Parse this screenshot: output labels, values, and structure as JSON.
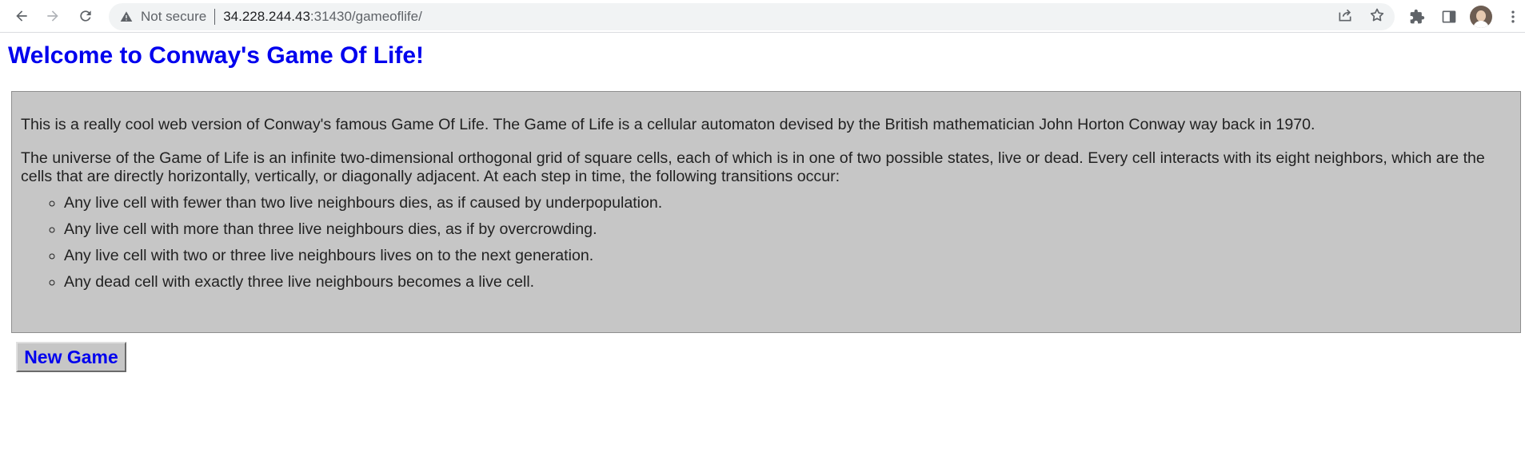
{
  "browser": {
    "security_label": "Not secure",
    "url_host": "34.228.244.43",
    "url_rest": ":31430/gameoflife/",
    "icons": {
      "back": "back-arrow-icon",
      "forward": "forward-arrow-icon",
      "reload": "reload-icon",
      "warning": "warning-triangle-icon",
      "share": "share-icon",
      "bookmark": "star-icon",
      "extensions": "puzzle-icon",
      "side_panel": "side-panel-icon",
      "profile": "avatar",
      "menu": "kebab-menu-icon"
    }
  },
  "page": {
    "title": "Welcome to Conway's Game Of Life!",
    "intro": "This is a really cool web version of Conway's famous Game Of Life. The Game of Life is a cellular automaton devised by the British mathematician John Horton Conway way back in 1970.",
    "description": "The universe of the Game of Life is an infinite two-dimensional orthogonal grid of square cells, each of which is in one of two possible states, live or dead. Every cell interacts with its eight neighbors, which are the cells that are directly horizontally, vertically, or diagonally adjacent. At each step in time, the following transitions occur:",
    "rules": [
      "Any live cell with fewer than two live neighbours dies, as if caused by underpopulation.",
      "Any live cell with more than three live neighbours dies, as if by overcrowding.",
      "Any live cell with two or three live neighbours lives on to the next generation.",
      "Any dead cell with exactly three live neighbours becomes a live cell."
    ],
    "new_game_label": "New Game"
  },
  "colors": {
    "title": "#0000ee",
    "panel_bg": "#c6c6c6",
    "text": "#222222"
  }
}
